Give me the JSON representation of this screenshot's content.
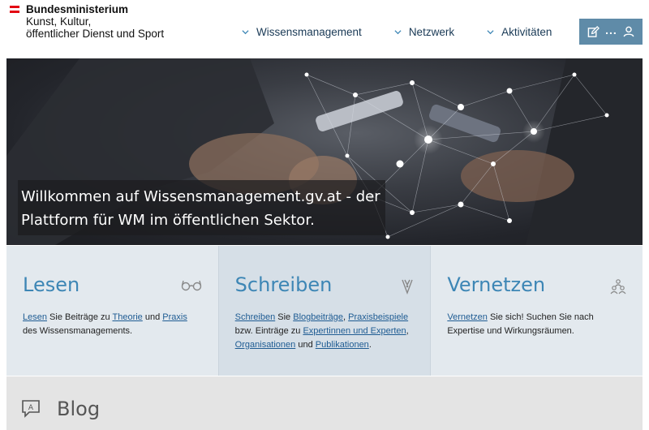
{
  "header": {
    "logo": {
      "line1": "Bundesministerium",
      "line2": "Kunst, Kultur,",
      "line3": "öffentlicher Dienst und Sport"
    },
    "nav": [
      {
        "label": "Wissensmanagement"
      },
      {
        "label": "Netzwerk"
      },
      {
        "label": "Aktivitäten"
      }
    ],
    "actions": {
      "edit_icon": "pencil-square-icon",
      "more_label": "...",
      "user_icon": "user-icon"
    }
  },
  "hero": {
    "caption_line1": "Willkommen auf Wissensmanagement.gv.at - der",
    "caption_line2": "Plattform für WM im öffentlichen Sektor."
  },
  "cards": [
    {
      "title": "Lesen",
      "icon": "glasses-icon",
      "parts": [
        {
          "t": "Lesen",
          "link": true
        },
        {
          "t": " Sie Beiträge zu "
        },
        {
          "t": "Theorie",
          "link": true
        },
        {
          "t": " und "
        },
        {
          "t": "Praxis",
          "link": true
        },
        {
          "t": " des Wissensmanagements."
        }
      ]
    },
    {
      "title": "Schreiben",
      "icon": "pen-nib-icon",
      "parts": [
        {
          "t": "Schreiben",
          "link": true
        },
        {
          "t": " Sie "
        },
        {
          "t": "Blogbeiträge",
          "link": true
        },
        {
          "t": ", "
        },
        {
          "t": "Praxisbeispiele",
          "link": true
        },
        {
          "t": " bzw. Einträge zu "
        },
        {
          "t": "Expertinnen und Experten",
          "link": true
        },
        {
          "t": ", "
        },
        {
          "t": "Organisationen",
          "link": true
        },
        {
          "t": " und "
        },
        {
          "t": "Publikationen",
          "link": true
        },
        {
          "t": "."
        }
      ]
    },
    {
      "title": "Vernetzen",
      "icon": "network-people-icon",
      "parts": [
        {
          "t": "Vernetzen",
          "link": true
        },
        {
          "t": " Sie sich! Suchen Sie nach Expertise und Wirkungsräumen."
        }
      ]
    }
  ],
  "blog": {
    "title": "Blog",
    "icon": "speech-bubble-icon"
  },
  "colors": {
    "flag_red": "#e30613",
    "nav_text": "#1a3a56",
    "action_bg": "#5f8ba8",
    "card_title": "#3d86b5",
    "link": "#1f5c93",
    "card_bg": "#e3e9ee",
    "card_bg_active": "#d6dfe7",
    "blog_bg": "#e4e4e4"
  }
}
